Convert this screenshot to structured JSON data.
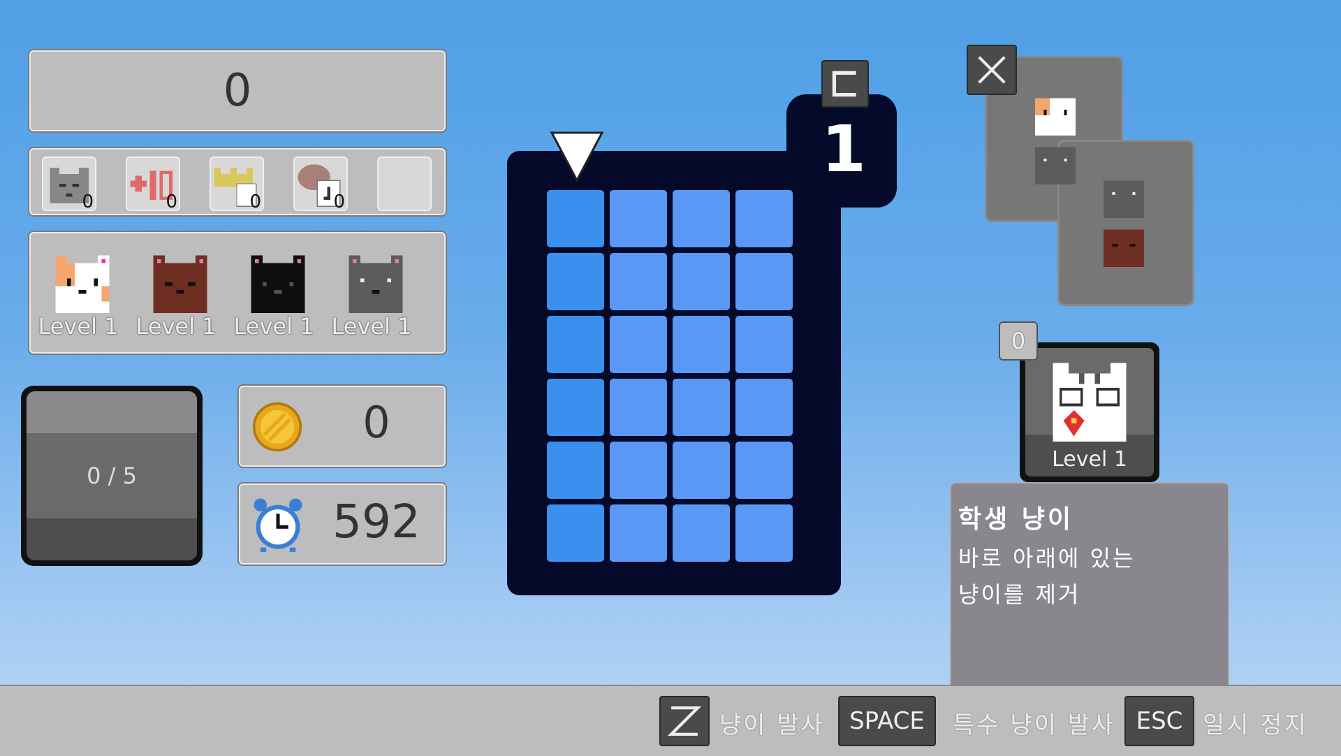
{
  "score": "0",
  "items": [
    {
      "name": "angry-cat-item",
      "count": "0"
    },
    {
      "name": "plus-ten-item",
      "count": "0"
    },
    {
      "name": "crown-item",
      "count": "0"
    },
    {
      "name": "palette-item",
      "count": "0"
    },
    {
      "name": "empty-item",
      "count": ""
    }
  ],
  "cats": [
    {
      "name": "calico",
      "label": "Level 1"
    },
    {
      "name": "brown",
      "label": "Level 1"
    },
    {
      "name": "black",
      "label": "Level 1"
    },
    {
      "name": "gray",
      "label": "Level 1"
    }
  ],
  "progress": "0 / 5",
  "coins": "0",
  "timer": "592",
  "board": {
    "next_label": "1",
    "hold_key": "C",
    "rows": 6,
    "cols": 4
  },
  "special": {
    "count": "0",
    "level": "Level 1",
    "title": "학생 냥이",
    "desc_line1": "바로 아래에 있는",
    "desc_line2": "냥이를 제거"
  },
  "controls": {
    "z_key": "Z",
    "z_action": "냥이 발사",
    "space_key": "SPACE",
    "space_action": "특수 냥이 발사",
    "esc_key": "ESC",
    "esc_action": "일시 정지"
  },
  "colors": {
    "board_bg": "#050a2a",
    "cell": "#5a98f5",
    "cell_first_col": "#3a90ee"
  }
}
